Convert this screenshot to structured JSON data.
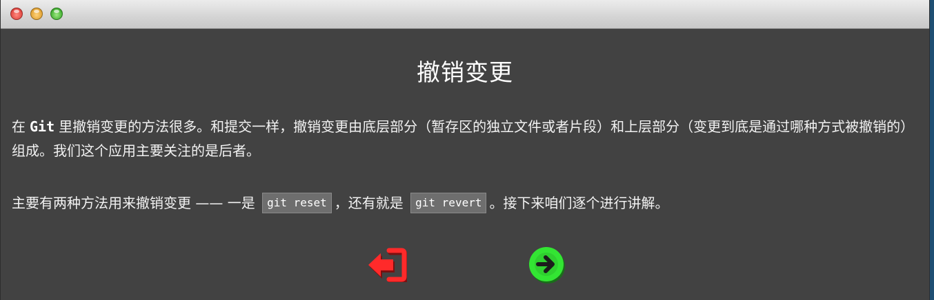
{
  "page": {
    "title": "撤销变更",
    "intro_before": "在",
    "intro_git": "Git",
    "intro_after": "里撤销变更的方法很多。和提交一样，撤销变更由底层部分（暂存区的独立文件或者片段）和上层部分（变更到底是通过哪种方式被撤销的）组成。我们这个应用主要关注的是后者。",
    "methods_before": "主要有两种方法用来撤销变更 —— 一是",
    "method_reset": "git reset",
    "methods_middle": "，还有就是",
    "method_revert": "git revert",
    "methods_after": "。接下来咱们逐个进行讲解。"
  },
  "nav": {
    "back_icon": "exit-arrow-left-icon",
    "next_icon": "circle-arrow-right-icon",
    "back_color": "#ff2a2a",
    "next_color": "#33e533"
  }
}
